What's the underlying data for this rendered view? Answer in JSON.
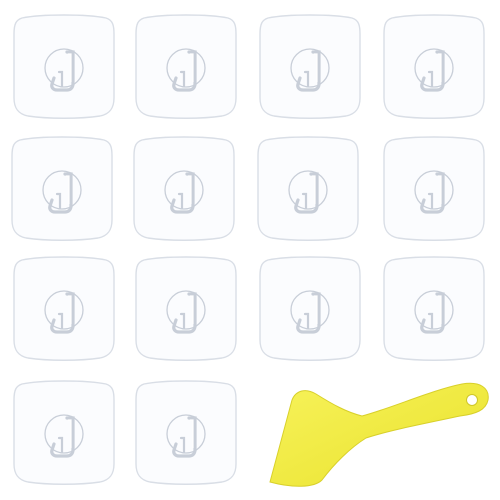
{
  "product": {
    "hooks": [
      {
        "id": "hook-1"
      },
      {
        "id": "hook-2"
      },
      {
        "id": "hook-3"
      },
      {
        "id": "hook-4"
      },
      {
        "id": "hook-5"
      },
      {
        "id": "hook-6"
      },
      {
        "id": "hook-7"
      },
      {
        "id": "hook-8"
      },
      {
        "id": "hook-9"
      },
      {
        "id": "hook-10"
      },
      {
        "id": "hook-11"
      },
      {
        "id": "hook-12"
      },
      {
        "id": "hook-13"
      },
      {
        "id": "hook-14"
      }
    ],
    "scraper": {
      "color": "#f3ee3c"
    }
  },
  "colors": {
    "background": "#ffffff",
    "pad_fill": "#fbfcfe",
    "pad_edge": "#d9dee6",
    "hook_shadow": "#c8ced8",
    "hook_highlight": "#ffffff"
  }
}
